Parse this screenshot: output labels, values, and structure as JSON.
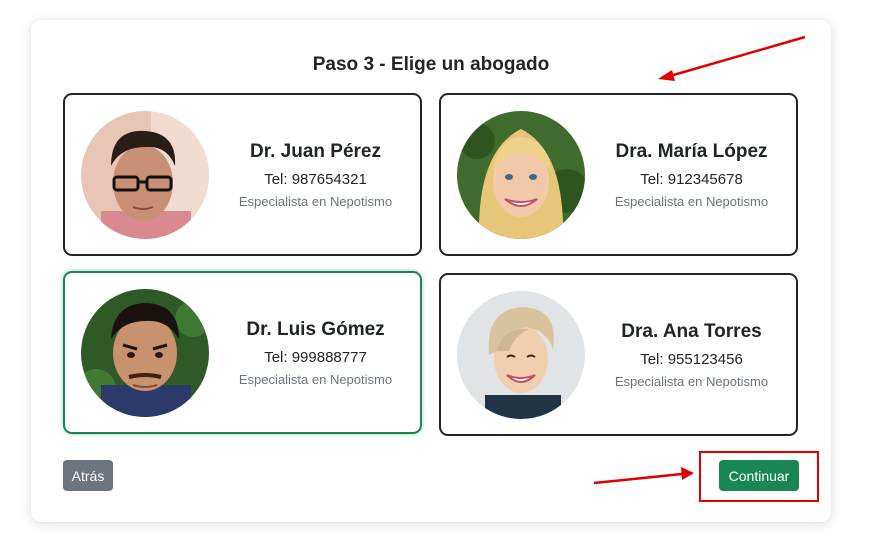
{
  "step_title": "Paso 3 - Elige un abogado",
  "lawyers": [
    {
      "name": "Dr. Juan Pérez",
      "tel": "Tel: 987654321",
      "specialty": "Especialista en Nepotismo",
      "selected": false
    },
    {
      "name": "Dra. María López",
      "tel": "Tel: 912345678",
      "specialty": "Especialista en Nepotismo",
      "selected": false
    },
    {
      "name": "Dr. Luis Gómez",
      "tel": "Tel: 999888777",
      "specialty": "Especialista en Nepotismo",
      "selected": true
    },
    {
      "name": "Dra. Ana Torres",
      "tel": "Tel: 955123456",
      "specialty": "Especialista en Nepotismo",
      "selected": false
    }
  ],
  "buttons": {
    "back": "Atrás",
    "continue": "Continuar"
  },
  "colors": {
    "border": "#212529",
    "selected_border": "#198754",
    "continue_bg": "#198754",
    "back_bg": "#6c757d",
    "annotation_red": "#e10000"
  }
}
